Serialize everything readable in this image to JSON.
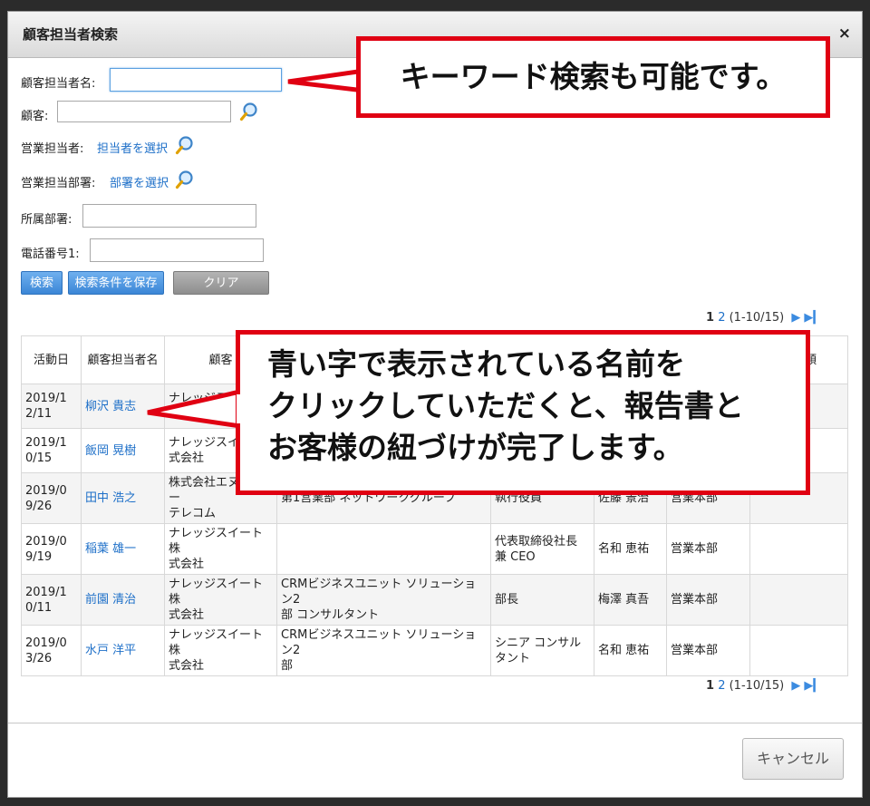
{
  "dialog": {
    "title": "顧客担当者検索",
    "close_symbol": "×"
  },
  "form": {
    "contact_name_label": "顧客担当者名:",
    "contact_name_value": "",
    "customer_label": "顧客:",
    "customer_value": "",
    "sales_rep_label": "営業担当者:",
    "sales_rep_link": "担当者を選択",
    "sales_dept_label": "営業担当部署:",
    "sales_dept_link": "部署を選択",
    "department_label": "所属部署:",
    "department_value": "",
    "phone_label": "電話番号1:",
    "phone_value": "",
    "search_button": "検索",
    "save_conditions_button": "検索条件を保存",
    "clear_button": "クリア"
  },
  "pagination": {
    "current_page": "1",
    "next_page": "2",
    "range": "(1-10/15)",
    "next_icon": "▶",
    "last_icon": "▶▎"
  },
  "table": {
    "headers": [
      "活動日",
      "顧客担当者名",
      "顧客",
      "",
      "",
      "",
      "",
      "者分類"
    ],
    "rows": [
      {
        "date": "2019/1\n2/11",
        "name": "柳沢 貴志",
        "customer": "ナレッジスイ\nト",
        "dept": "",
        "title": "",
        "rep": "",
        "sales_dept": "",
        "category": ""
      },
      {
        "date": "2019/1\n0/15",
        "name": "飯岡 晃樹",
        "customer": "ナレッジスイ\n式会社",
        "dept": "",
        "title": "",
        "rep": "",
        "sales_dept": "",
        "category": ""
      },
      {
        "date": "2019/0\n9/26",
        "name": "田中 浩之",
        "customer": "株式会社エヌディー\nテレコム",
        "dept": "第1営業部 ネットワークグループ",
        "title": "執行役員",
        "rep": "佐藤 景治",
        "sales_dept": "営業本部",
        "category": ""
      },
      {
        "date": "2019/0\n9/19",
        "name": "稲葉 雄一",
        "customer": "ナレッジスイート株\n式会社",
        "dept": "",
        "title": "代表取締役社長\n兼 CEO",
        "rep": "名和 恵祐",
        "sales_dept": "営業本部",
        "category": ""
      },
      {
        "date": "2019/1\n0/11",
        "name": "前園 清治",
        "customer": "ナレッジスイート株\n式会社",
        "dept": "CRMビジネスユニット ソリューション2\n部 コンサルタント",
        "title": "部長",
        "rep": "梅澤 真吾",
        "sales_dept": "営業本部",
        "category": ""
      },
      {
        "date": "2019/0\n3/26",
        "name": "水戸 洋平",
        "customer": "ナレッジスイート株\n式会社",
        "dept": "CRMビジネスユニット ソリューション2\n部",
        "title": "シニア コンサル\nタント",
        "rep": "名和 恵祐",
        "sales_dept": "営業本部",
        "category": ""
      }
    ]
  },
  "footer": {
    "cancel_button": "キャンセル"
  },
  "annotations": {
    "callout1": "キーワード検索も可能です。",
    "callout2_lines": [
      "青い字で表示されている名前を",
      "クリックしていただくと、報告書と",
      "お客様の紐づけが完了します。"
    ]
  },
  "colors": {
    "link_blue": "#1d6fc8",
    "callout_red": "#e00012",
    "button_blue": "#3b86d6"
  }
}
